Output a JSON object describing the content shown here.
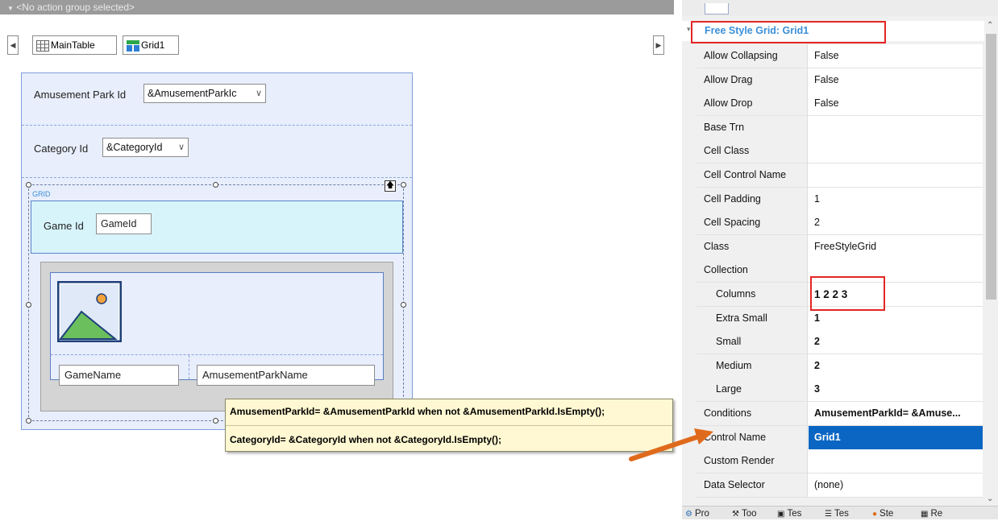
{
  "designer": {
    "action_group": "<No action group selected>",
    "tabs": [
      {
        "label": "MainTable"
      },
      {
        "label": "Grid1"
      }
    ],
    "fields": {
      "amusement_park_label": "Amusement Park Id",
      "amusement_park_value": "&AmusementParkIc",
      "category_label": "Category Id",
      "category_value": "&CategoryId",
      "grid_caption": "GRID",
      "game_id_label": "Game Id",
      "game_id_value": "GameId",
      "game_name": "GameName",
      "amusement_park_name": "AmusementParkName"
    }
  },
  "tooltip": {
    "line1": "AmusementParkId= &AmusementParkId when not &AmusementParkId.IsEmpty();",
    "line2": "CategoryId= &CategoryId when not &CategoryId.IsEmpty();"
  },
  "properties": {
    "section_title": "Free Style Grid: Grid1",
    "rows": [
      {
        "name": "Allow Collapsing",
        "value": "False"
      },
      {
        "name": "Allow Drag",
        "value": "False"
      },
      {
        "name": "Allow Drop",
        "value": "False"
      },
      {
        "name": "Base Trn",
        "value": ""
      },
      {
        "name": "Cell Class",
        "value": ""
      },
      {
        "name": "Cell Control Name",
        "value": ""
      },
      {
        "name": "Cell Padding",
        "value": "1"
      },
      {
        "name": "Cell Spacing",
        "value": "2"
      },
      {
        "name": "Class",
        "value": "FreeStyleGrid"
      },
      {
        "name": "Collection",
        "value": ""
      },
      {
        "name": "Columns",
        "value": "1 2 2 3"
      },
      {
        "name": "Extra Small",
        "value": "1"
      },
      {
        "name": "Small",
        "value": "2"
      },
      {
        "name": "Medium",
        "value": "2"
      },
      {
        "name": "Large",
        "value": "3"
      },
      {
        "name": "Conditions",
        "value": "AmusementParkId= &Amuse..."
      },
      {
        "name": "Control Name",
        "value": "Grid1"
      },
      {
        "name": "Custom Render",
        "value": ""
      },
      {
        "name": "Data Selector",
        "value": "(none)"
      }
    ]
  },
  "bottom_tabs": [
    {
      "label": "Pro"
    },
    {
      "label": "Too"
    },
    {
      "label": "Tes"
    },
    {
      "label": "Tes"
    },
    {
      "label": "Ste"
    },
    {
      "label": "Re"
    }
  ],
  "colors": {
    "selection": "#0a66c2",
    "highlight_box": "#e32626",
    "arrow": "#e06a1b",
    "section_title": "#3a8fd9"
  }
}
